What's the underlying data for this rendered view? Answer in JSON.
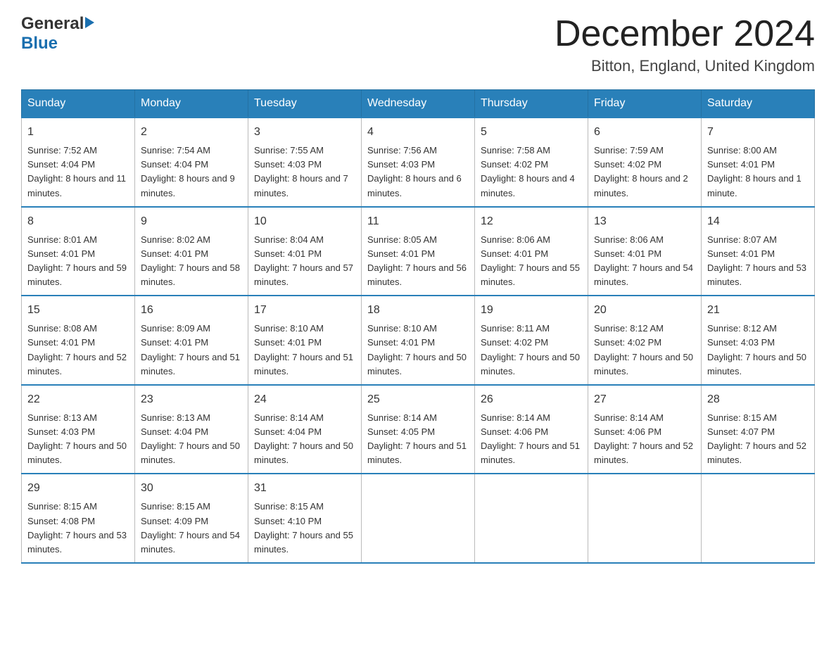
{
  "header": {
    "logo_general": "General",
    "logo_blue": "Blue",
    "month_title": "December 2024",
    "location": "Bitton, England, United Kingdom"
  },
  "days_of_week": [
    "Sunday",
    "Monday",
    "Tuesday",
    "Wednesday",
    "Thursday",
    "Friday",
    "Saturday"
  ],
  "weeks": [
    [
      {
        "day": "1",
        "sunrise": "7:52 AM",
        "sunset": "4:04 PM",
        "daylight": "8 hours and 11 minutes."
      },
      {
        "day": "2",
        "sunrise": "7:54 AM",
        "sunset": "4:04 PM",
        "daylight": "8 hours and 9 minutes."
      },
      {
        "day": "3",
        "sunrise": "7:55 AM",
        "sunset": "4:03 PM",
        "daylight": "8 hours and 7 minutes."
      },
      {
        "day": "4",
        "sunrise": "7:56 AM",
        "sunset": "4:03 PM",
        "daylight": "8 hours and 6 minutes."
      },
      {
        "day": "5",
        "sunrise": "7:58 AM",
        "sunset": "4:02 PM",
        "daylight": "8 hours and 4 minutes."
      },
      {
        "day": "6",
        "sunrise": "7:59 AM",
        "sunset": "4:02 PM",
        "daylight": "8 hours and 2 minutes."
      },
      {
        "day": "7",
        "sunrise": "8:00 AM",
        "sunset": "4:01 PM",
        "daylight": "8 hours and 1 minute."
      }
    ],
    [
      {
        "day": "8",
        "sunrise": "8:01 AM",
        "sunset": "4:01 PM",
        "daylight": "7 hours and 59 minutes."
      },
      {
        "day": "9",
        "sunrise": "8:02 AM",
        "sunset": "4:01 PM",
        "daylight": "7 hours and 58 minutes."
      },
      {
        "day": "10",
        "sunrise": "8:04 AM",
        "sunset": "4:01 PM",
        "daylight": "7 hours and 57 minutes."
      },
      {
        "day": "11",
        "sunrise": "8:05 AM",
        "sunset": "4:01 PM",
        "daylight": "7 hours and 56 minutes."
      },
      {
        "day": "12",
        "sunrise": "8:06 AM",
        "sunset": "4:01 PM",
        "daylight": "7 hours and 55 minutes."
      },
      {
        "day": "13",
        "sunrise": "8:06 AM",
        "sunset": "4:01 PM",
        "daylight": "7 hours and 54 minutes."
      },
      {
        "day": "14",
        "sunrise": "8:07 AM",
        "sunset": "4:01 PM",
        "daylight": "7 hours and 53 minutes."
      }
    ],
    [
      {
        "day": "15",
        "sunrise": "8:08 AM",
        "sunset": "4:01 PM",
        "daylight": "7 hours and 52 minutes."
      },
      {
        "day": "16",
        "sunrise": "8:09 AM",
        "sunset": "4:01 PM",
        "daylight": "7 hours and 51 minutes."
      },
      {
        "day": "17",
        "sunrise": "8:10 AM",
        "sunset": "4:01 PM",
        "daylight": "7 hours and 51 minutes."
      },
      {
        "day": "18",
        "sunrise": "8:10 AM",
        "sunset": "4:01 PM",
        "daylight": "7 hours and 50 minutes."
      },
      {
        "day": "19",
        "sunrise": "8:11 AM",
        "sunset": "4:02 PM",
        "daylight": "7 hours and 50 minutes."
      },
      {
        "day": "20",
        "sunrise": "8:12 AM",
        "sunset": "4:02 PM",
        "daylight": "7 hours and 50 minutes."
      },
      {
        "day": "21",
        "sunrise": "8:12 AM",
        "sunset": "4:03 PM",
        "daylight": "7 hours and 50 minutes."
      }
    ],
    [
      {
        "day": "22",
        "sunrise": "8:13 AM",
        "sunset": "4:03 PM",
        "daylight": "7 hours and 50 minutes."
      },
      {
        "day": "23",
        "sunrise": "8:13 AM",
        "sunset": "4:04 PM",
        "daylight": "7 hours and 50 minutes."
      },
      {
        "day": "24",
        "sunrise": "8:14 AM",
        "sunset": "4:04 PM",
        "daylight": "7 hours and 50 minutes."
      },
      {
        "day": "25",
        "sunrise": "8:14 AM",
        "sunset": "4:05 PM",
        "daylight": "7 hours and 51 minutes."
      },
      {
        "day": "26",
        "sunrise": "8:14 AM",
        "sunset": "4:06 PM",
        "daylight": "7 hours and 51 minutes."
      },
      {
        "day": "27",
        "sunrise": "8:14 AM",
        "sunset": "4:06 PM",
        "daylight": "7 hours and 52 minutes."
      },
      {
        "day": "28",
        "sunrise": "8:15 AM",
        "sunset": "4:07 PM",
        "daylight": "7 hours and 52 minutes."
      }
    ],
    [
      {
        "day": "29",
        "sunrise": "8:15 AM",
        "sunset": "4:08 PM",
        "daylight": "7 hours and 53 minutes."
      },
      {
        "day": "30",
        "sunrise": "8:15 AM",
        "sunset": "4:09 PM",
        "daylight": "7 hours and 54 minutes."
      },
      {
        "day": "31",
        "sunrise": "8:15 AM",
        "sunset": "4:10 PM",
        "daylight": "7 hours and 55 minutes."
      },
      null,
      null,
      null,
      null
    ]
  ],
  "labels": {
    "sunrise": "Sunrise:",
    "sunset": "Sunset:",
    "daylight": "Daylight:"
  }
}
